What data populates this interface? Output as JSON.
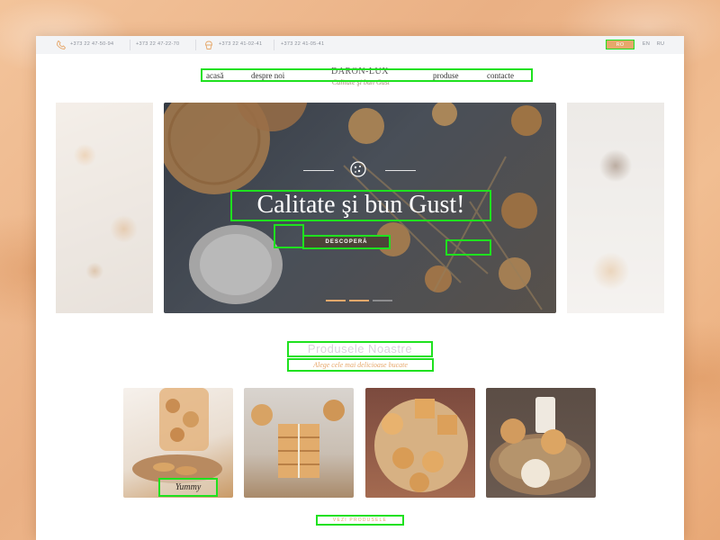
{
  "topbar": {
    "phones": [
      "+373 22 47-50-94",
      "+373 22 47-22-70",
      "+373 22 41-02-41",
      "+373 22 41-05-41"
    ],
    "languages": [
      {
        "label": "RO",
        "active": true
      },
      {
        "label": "EN",
        "active": false
      },
      {
        "label": "RU",
        "active": false
      }
    ],
    "icons": [
      "phone-icon",
      "cupcake-icon"
    ]
  },
  "logo": {
    "name": "DARON-LUX",
    "tagline": "Calitate şi bun Gust"
  },
  "nav": {
    "items": [
      "acasă",
      "despre noi",
      "produse",
      "contacte"
    ]
  },
  "hero": {
    "title": "Calitate şi bun Gust!",
    "button": "DESCOPERĂ",
    "icon": "cookie-icon",
    "slides": 3,
    "active_slide": 0
  },
  "products": {
    "title": "Produsele Noastre",
    "subtitle": "Alege cele mai delicioase bucate",
    "items": [
      {
        "label": "Yummy"
      },
      {
        "label": ""
      },
      {
        "label": ""
      },
      {
        "label": ""
      }
    ],
    "view_all": "VEZI PRODUSELE"
  },
  "colors": {
    "accent": "#e6a86b",
    "annotation": "#1fe11f",
    "topbar_bg": "#f3f4f6"
  }
}
